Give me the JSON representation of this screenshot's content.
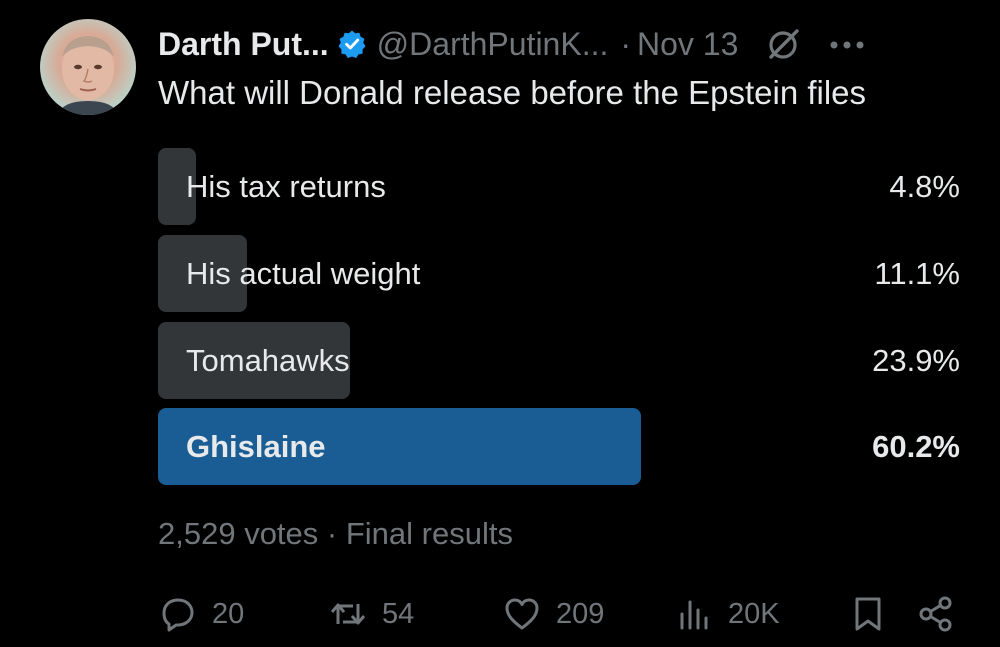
{
  "author": {
    "display_name": "Darth Put...",
    "handle": "@DarthPutinK...",
    "separator": "·",
    "date": "Nov 13",
    "verified": true,
    "verified_color": "#1d9bf0"
  },
  "tweet": {
    "text": "What will Donald release before the Epstein files"
  },
  "poll": {
    "options": [
      {
        "label": "His tax returns",
        "percent_label": "4.8%",
        "percent": 4.8,
        "winner": false
      },
      {
        "label": "His actual weight",
        "percent_label": "11.1%",
        "percent": 11.1,
        "winner": false
      },
      {
        "label": "Tomahawks",
        "percent_label": "23.9%",
        "percent": 23.9,
        "winner": false
      },
      {
        "label": "Ghislaine",
        "percent_label": "60.2%",
        "percent": 60.2,
        "winner": true
      }
    ],
    "meta": "2,529 votes · Final results",
    "bar_color": "#333639",
    "winner_color": "#1a5d94"
  },
  "actions": {
    "replies": "20",
    "reposts": "54",
    "likes": "209",
    "views": "20K"
  },
  "icons": [
    "verified-badge-icon",
    "grok-icon",
    "more-icon",
    "reply-icon",
    "repost-icon",
    "like-icon",
    "views-icon",
    "bookmark-icon",
    "share-icon"
  ]
}
